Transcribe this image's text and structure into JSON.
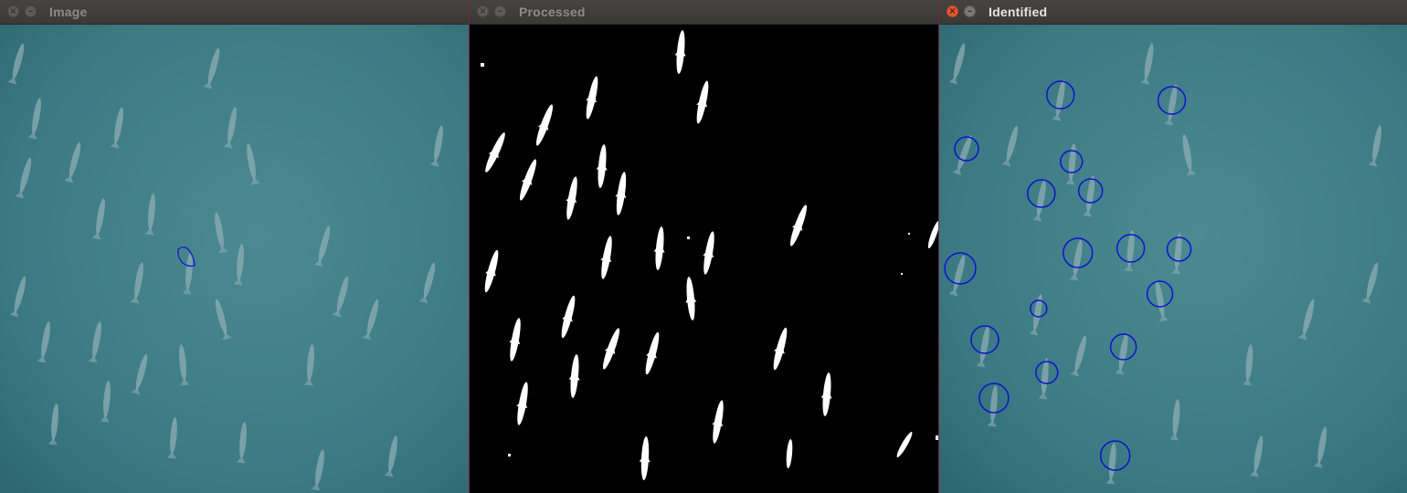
{
  "windows": [
    {
      "title": "Image",
      "close_glyph": "×",
      "min_glyph": "–",
      "content": "aerial-dolphins-photo-with-contour"
    },
    {
      "title": "Processed",
      "close_glyph": "×",
      "min_glyph": "–",
      "content": "binary-threshold-mask"
    },
    {
      "title": "Identified",
      "close_glyph": "×",
      "min_glyph": "–",
      "content": "aerial-dolphins-photo-with-detection-circles"
    }
  ],
  "detections_count": 20,
  "colors": {
    "water": "#3f7f86",
    "water_dark": "#2f6a74",
    "dolphin": "#8fb0b4",
    "mask_bg": "#000000",
    "mask_fg": "#ffffff",
    "circle": "#1010d8"
  }
}
